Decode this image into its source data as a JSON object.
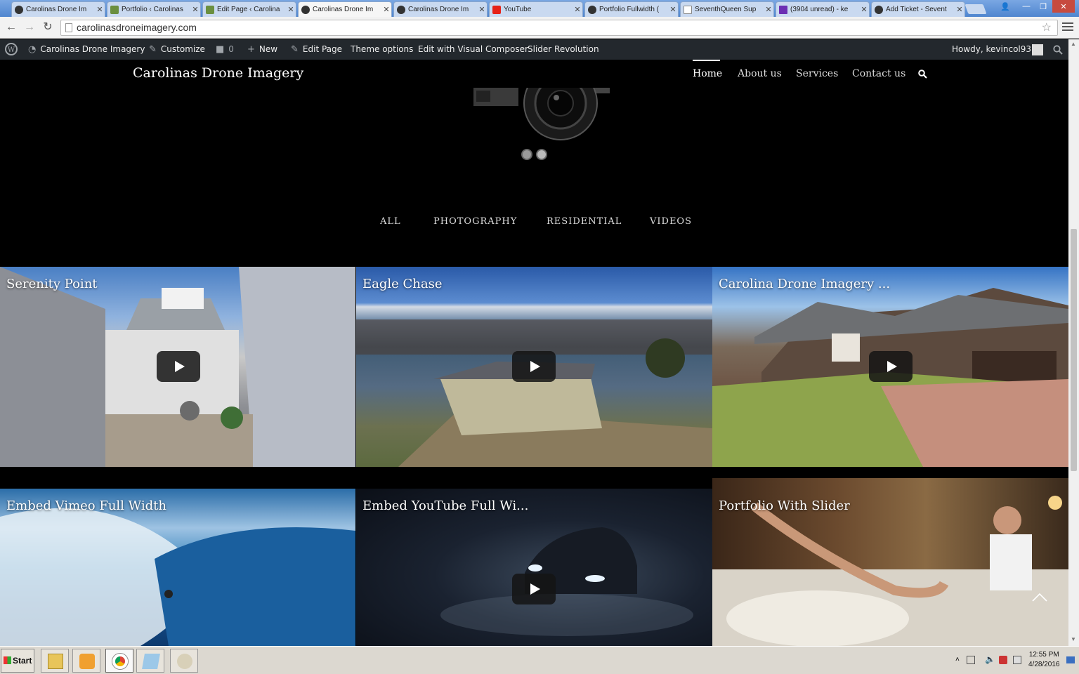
{
  "browser": {
    "tabs": [
      {
        "label": "Carolinas Drone Im",
        "icon": "chrome-o-icon",
        "active": false
      },
      {
        "label": "Portfolio ‹ Carolinas",
        "icon": "wordpress-house-icon",
        "active": false
      },
      {
        "label": "Edit Page ‹ Carolina",
        "icon": "wordpress-house-icon",
        "active": false
      },
      {
        "label": "Carolinas Drone Im",
        "icon": "chrome-o-icon",
        "active": true
      },
      {
        "label": "Carolinas Drone Im",
        "icon": "chrome-o-icon",
        "active": false
      },
      {
        "label": "YouTube",
        "icon": "youtube-icon",
        "active": false
      },
      {
        "label": "Portfolio Fullwidth (",
        "icon": "chrome-o-icon",
        "active": false
      },
      {
        "label": "SeventhQueen Sup",
        "icon": "document-icon",
        "active": false
      },
      {
        "label": "(3904 unread) - ke",
        "icon": "mail-icon",
        "active": false
      },
      {
        "label": "Add Ticket - Sevent",
        "icon": "chrome-o-icon",
        "active": false
      }
    ],
    "url": "carolinasdroneimagery.com"
  },
  "adminbar": {
    "site_name": "Carolinas Drone Imagery",
    "customize": "Customize",
    "comments_count": "0",
    "new": "New",
    "edit_page": "Edit Page",
    "theme_options": "Theme options",
    "visual_composer": "Edit with Visual Composer",
    "slider_revolution": "Slider Revolution",
    "howdy": "Howdy, kevincol931"
  },
  "site": {
    "title": "Carolinas Drone Imagery",
    "nav": [
      "Home",
      "About us",
      "Services",
      "Contact us"
    ],
    "active_nav": "Home"
  },
  "filters": [
    "ALL",
    "PHOTOGRAPHY",
    "RESIDENTIAL",
    "VIDEOS"
  ],
  "portfolio": [
    {
      "title": "Serenity Point",
      "has_play": true
    },
    {
      "title": "Eagle Chase",
      "has_play": true
    },
    {
      "title": "Carolina Drone Imagery ...",
      "has_play": true
    },
    {
      "title": "Embed Vimeo Full Width",
      "has_play": false
    },
    {
      "title": "Embed YouTube Full Wi...",
      "has_play": true
    },
    {
      "title": "Portfolio With Slider",
      "has_play": false
    }
  ],
  "slider": {
    "dots": 2,
    "active_dot": 1
  },
  "taskbar": {
    "start": "Start",
    "apps": [
      "file-explorer-icon",
      "media-player-icon",
      "chrome-icon",
      "notepad-icon",
      "paint-icon"
    ],
    "time": "12:55 PM",
    "date": "4/28/2016"
  },
  "colors": {
    "page_bg": "#000000",
    "adminbar_bg": "#23282d",
    "tabbar": "#4f86cf"
  }
}
